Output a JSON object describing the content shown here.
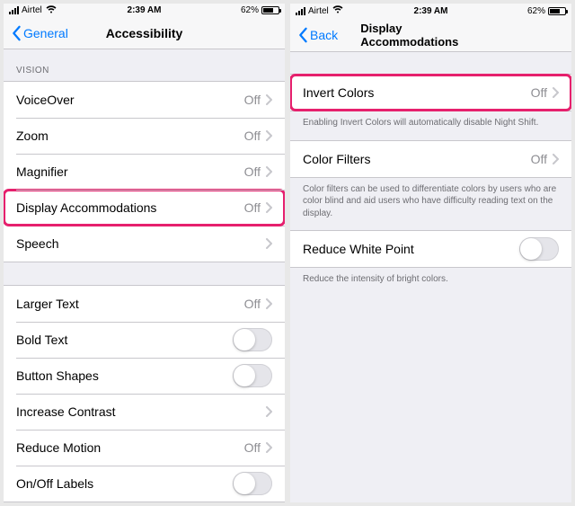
{
  "status": {
    "carrier": "Airtel",
    "wifi": true,
    "time": "2:39 AM",
    "battery_pct": "62%"
  },
  "left": {
    "back_label": "General",
    "title": "Accessibility",
    "section_vision": "VISION",
    "rows": {
      "voiceover": {
        "label": "VoiceOver",
        "value": "Off"
      },
      "zoom": {
        "label": "Zoom",
        "value": "Off"
      },
      "magnifier": {
        "label": "Magnifier",
        "value": "Off"
      },
      "display_accom": {
        "label": "Display Accommodations",
        "value": "Off"
      },
      "speech": {
        "label": "Speech"
      },
      "larger_text": {
        "label": "Larger Text",
        "value": "Off"
      },
      "bold_text": {
        "label": "Bold Text"
      },
      "button_shapes": {
        "label": "Button Shapes"
      },
      "increase_contrast": {
        "label": "Increase Contrast"
      },
      "reduce_motion": {
        "label": "Reduce Motion",
        "value": "Off"
      },
      "onoff_labels": {
        "label": "On/Off Labels"
      }
    }
  },
  "right": {
    "back_label": "Back",
    "title": "Display Accommodations",
    "rows": {
      "invert": {
        "label": "Invert Colors",
        "value": "Off"
      },
      "invert_footer": "Enabling Invert Colors will automatically disable Night Shift.",
      "filters": {
        "label": "Color Filters",
        "value": "Off"
      },
      "filters_footer": "Color filters can be used to differentiate colors by users who are color blind and aid users who have difficulty reading text on the display.",
      "rwp": {
        "label": "Reduce White Point"
      },
      "rwp_footer": "Reduce the intensity of bright colors."
    }
  }
}
